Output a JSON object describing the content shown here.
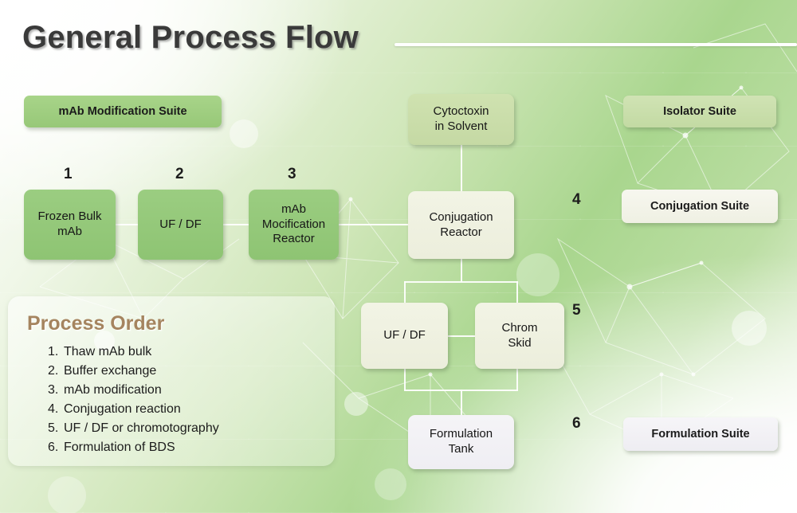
{
  "slide": {
    "title": "General Process Flow",
    "accent_green": "#8ec473",
    "accent_light_green": "#c5d9a4",
    "accent_cream": "#eceedc",
    "accent_white": "#efeef3",
    "title_color": "#3a3a3a",
    "panel_title_color": "#a5845f"
  },
  "suites": [
    {
      "id": "mab-modification-suite",
      "label": "mAb Modification Suite",
      "style": "green"
    },
    {
      "id": "isolator-suite",
      "label": "Isolator Suite",
      "style": "lgreen"
    },
    {
      "id": "conjugation-suite",
      "label": "Conjugation Suite",
      "style": "cream"
    },
    {
      "id": "formulation-suite",
      "label": "Formulation Suite",
      "style": "white"
    }
  ],
  "step_numbers": [
    "1",
    "2",
    "3",
    "4",
    "5",
    "6"
  ],
  "nodes": [
    {
      "id": "frozen-bulk-mab",
      "line1": "Frozen Bulk",
      "line2": "mAb",
      "style": "green"
    },
    {
      "id": "uf-df-upstream",
      "line1": "UF / DF",
      "line2": "",
      "style": "green"
    },
    {
      "id": "mab-modification-reactor",
      "line1": "mAb",
      "line2": "Mocification",
      "line3": "Reactor",
      "style": "green"
    },
    {
      "id": "cytoctoxin-in-solvent",
      "line1": "Cytoctoxin",
      "line2": "in Solvent",
      "style": "lgreen"
    },
    {
      "id": "conjugation-reactor",
      "line1": "Conjugation",
      "line2": "Reactor",
      "style": "cream"
    },
    {
      "id": "uf-df-downstream",
      "line1": "UF / DF",
      "line2": "",
      "style": "cream"
    },
    {
      "id": "chrom-skid",
      "line1": "Chrom",
      "line2": "Skid",
      "style": "cream"
    },
    {
      "id": "formulation-tank",
      "line1": "Formulation",
      "line2": "Tank",
      "style": "white"
    }
  ],
  "process_order": {
    "title": "Process Order",
    "items": [
      {
        "num": "1.",
        "text": "Thaw mAb bulk"
      },
      {
        "num": "2.",
        "text": "Buffer exchange"
      },
      {
        "num": "3.",
        "text": "mAb modification"
      },
      {
        "num": "4.",
        "text": "Conjugation reaction"
      },
      {
        "num": "5.",
        "text": "UF / DF or chromotography"
      },
      {
        "num": "6.",
        "text": "Formulation of BDS"
      }
    ]
  }
}
